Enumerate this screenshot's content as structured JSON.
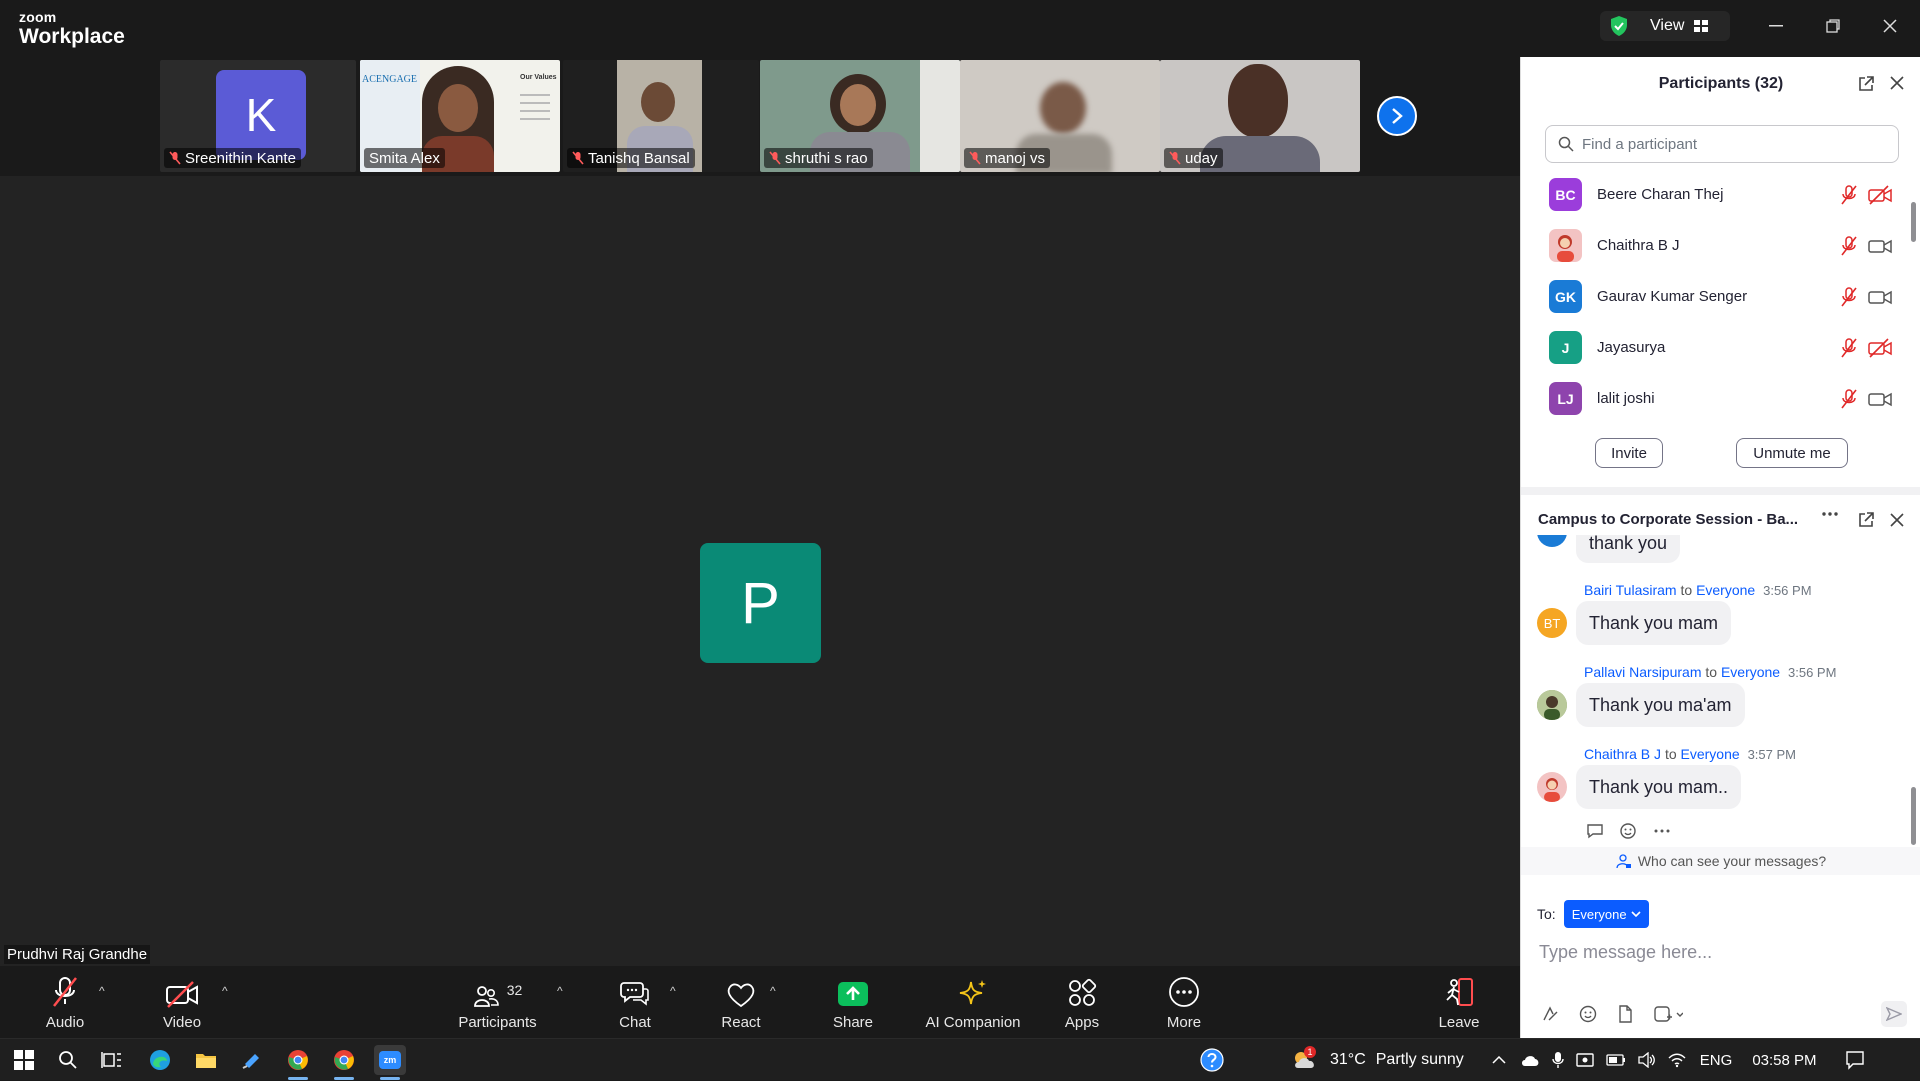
{
  "window": {
    "brand_top": "zoom",
    "brand_bottom": "Workplace",
    "view_label": "View"
  },
  "strip": {
    "tiles": [
      {
        "name": "Sreenithin Kante",
        "avatar_letter": "K",
        "muted": true
      },
      {
        "name": "Smita Alex",
        "muted": false,
        "slide_brand": "ACENGAGE",
        "slide_heading": "Our Values"
      },
      {
        "name": "Tanishq Bansal",
        "muted": true
      },
      {
        "name": "shruthi s rao",
        "muted": true
      },
      {
        "name": "manoj vs",
        "muted": true
      },
      {
        "name": "uday",
        "muted": true
      }
    ]
  },
  "stage": {
    "avatar_letter": "P",
    "speaker_name": "Prudhvi Raj Grandhe",
    "avatar_color": "#0a8a76"
  },
  "toolbar": {
    "audio": "Audio",
    "video": "Video",
    "participants": "Participants",
    "participants_count": "32",
    "chat": "Chat",
    "react": "React",
    "share": "Share",
    "ai_companion": "AI Companion",
    "apps": "Apps",
    "more": "More",
    "leave": "Leave"
  },
  "participants_panel": {
    "title": "Participants (32)",
    "search_placeholder": "Find a participant",
    "items": [
      {
        "initials": "BC",
        "name": "Beere Charan Thej",
        "color": "#9b3ddb",
        "video_off": true
      },
      {
        "initials": "",
        "name": "Chaithra B J",
        "color": "#f3c3c3",
        "video_off": false
      },
      {
        "initials": "GK",
        "name": "Gaurav Kumar Senger",
        "color": "#1a7bd6",
        "video_off": false
      },
      {
        "initials": "J",
        "name": "Jayasurya",
        "color": "#16a085",
        "video_off": true
      },
      {
        "initials": "LJ",
        "name": "lalit joshi",
        "color": "#8e44ad",
        "video_off": false
      }
    ],
    "invite": "Invite",
    "unmute": "Unmute me"
  },
  "chat_panel": {
    "title": "Campus to Corporate Session - Ba...",
    "partial_message": "thank you",
    "messages": [
      {
        "sender": "Bairi Tulasiram",
        "to": "to",
        "recipient": "Everyone",
        "time": "3:56 PM",
        "text": "Thank you mam",
        "initials": "BT",
        "color": "#f5a623"
      },
      {
        "sender": "Pallavi Narsipuram",
        "to": "to",
        "recipient": "Everyone",
        "time": "3:56 PM",
        "text": "Thank you ma'am",
        "initials": "",
        "color": "#8aa06a"
      },
      {
        "sender": "Chaithra B J",
        "to": "to",
        "recipient": "Everyone",
        "time": "3:57 PM",
        "text": "Thank you mam..",
        "initials": "",
        "color": "#f3c3c3"
      }
    ],
    "who_can_see": "Who can see your messages?",
    "to_label": "To:",
    "to_value": "Everyone",
    "input_placeholder": "Type message here..."
  },
  "taskbar": {
    "temperature": "31°C",
    "weather": "Partly sunny",
    "weather_badge": "1",
    "language": "ENG",
    "time": "03:58 PM",
    "zoom_label": "zm"
  }
}
